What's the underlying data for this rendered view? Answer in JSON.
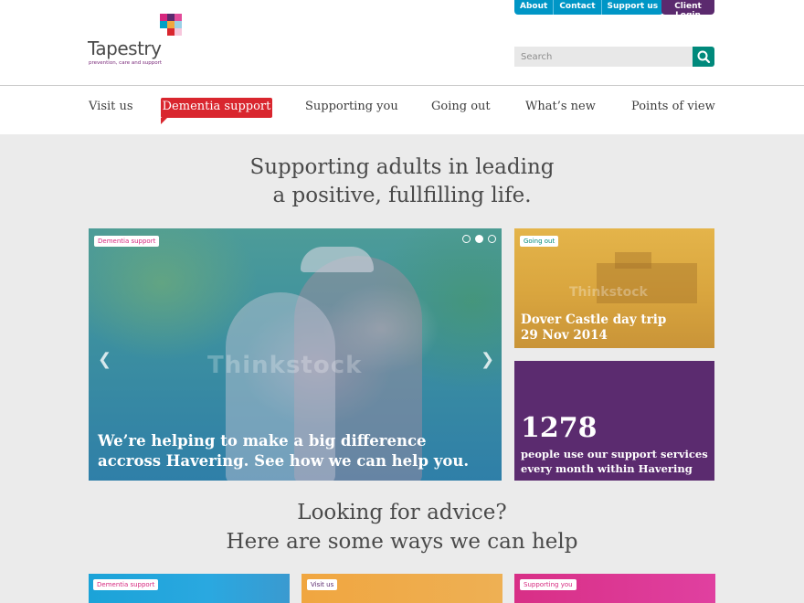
{
  "brand": {
    "name": "Tapestry",
    "tagline": "prevention, care and support",
    "colors": {
      "pink": "#d6277e",
      "teal": "#00897b",
      "blue": "#0096c6",
      "purple": "#5b2a6e",
      "red": "#d9262e",
      "gold": "#d9a53e"
    }
  },
  "top_links": [
    "About",
    "Contact",
    "Support us"
  ],
  "client_login": "Client Login",
  "search": {
    "placeholder": "Search",
    "button_icon": "search-icon"
  },
  "nav": {
    "items": [
      "Visit us",
      "Dementia support",
      "Supporting you",
      "Going out",
      "What’s new",
      "Points of view"
    ],
    "active": "Dementia support"
  },
  "hero": {
    "line1": "Supporting adults in leading",
    "line2": "a positive, fullfilling life."
  },
  "slider": {
    "tag": "Dementia support",
    "watermark": "Thinkstock",
    "caption_line1": "We’re helping to make a big difference",
    "caption_line2": "accross Havering. See how we can help you.",
    "slides": 3,
    "current_slide": 2,
    "prev_icon": "chevron-left-icon",
    "next_icon": "chevron-right-icon"
  },
  "cards": {
    "dover": {
      "tag": "Going out",
      "watermark": "Thinkstock",
      "title_line1": "Dover Castle day trip",
      "title_line2": "29 Nov 2014"
    },
    "stat": {
      "number": "1278",
      "line1": "people use our support services",
      "line2": "every month within Havering"
    }
  },
  "advice": {
    "line1": "Looking for advice?",
    "line2": "Here are some ways we can help",
    "cards": [
      {
        "tag": "Dementia support",
        "color": "#1ba3d8",
        "tag_color": "#d6277e"
      },
      {
        "tag": "Visit us",
        "color": "#f0a640",
        "tag_color": "#5b2a6e"
      },
      {
        "tag": "Supporting you",
        "color": "#d82f86",
        "tag_color": "#d6277e"
      }
    ]
  }
}
